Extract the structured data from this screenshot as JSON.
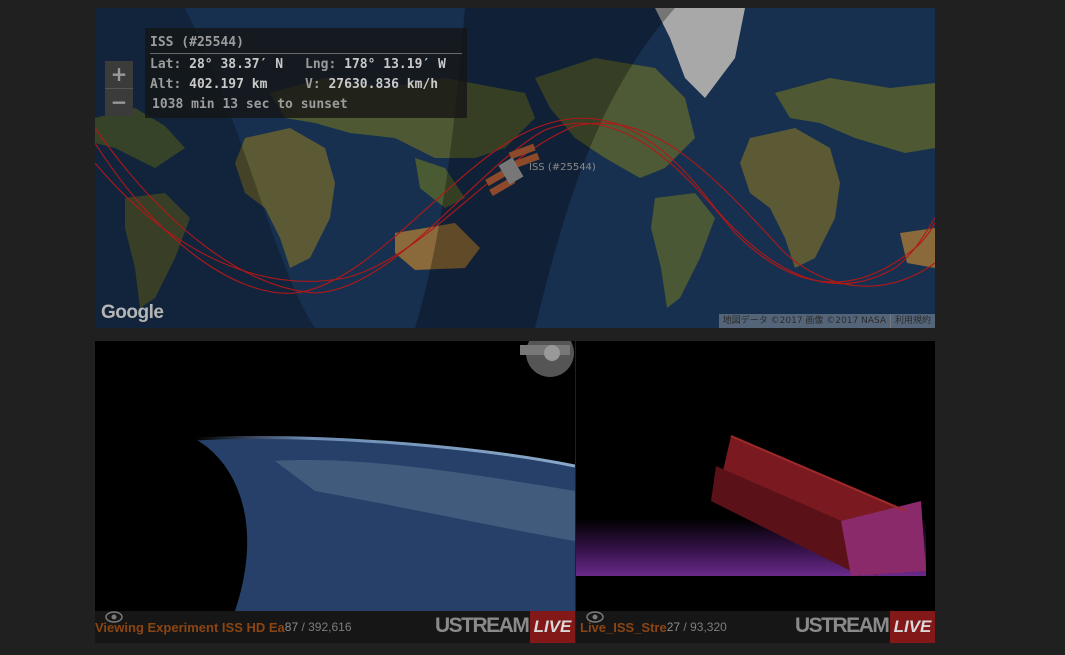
{
  "map": {
    "zoom_in_label": "+",
    "zoom_out_label": "−",
    "google_logo": "Google",
    "attribution": "地図データ ©2017 画像 ©2017 NASA",
    "terms_link": "利用規約",
    "iss_marker_label": "ISS (#25544)",
    "orbit_color": "#b01818"
  },
  "info_panel": {
    "title": "ISS (#25544)",
    "lat_label": "Lat:",
    "lat_value": "28° 38.37′ N",
    "lng_label": "Lng:",
    "lng_value": "178° 13.19′ W",
    "alt_label": "Alt:",
    "alt_value": "402.197 km",
    "vel_label": "V:",
    "vel_value": "27630.836 km/h",
    "sunset_text": "1038 min 13 sec to sunset"
  },
  "players": [
    {
      "ticker": "Viewing Experiment    ISS HD Ea",
      "viewers_now": "87",
      "viewers_total": "/ 392,616",
      "brand": "USTREAM",
      "live_label": "LIVE"
    },
    {
      "ticker": "Live_ISS_Stre",
      "viewers_now": "27",
      "viewers_total": "/ 93,320",
      "brand": "USTREAM",
      "live_label": "LIVE"
    }
  ],
  "colors": {
    "live_badge": "#821818",
    "ticker_text": "#8b4512",
    "page_background": "#202020"
  }
}
